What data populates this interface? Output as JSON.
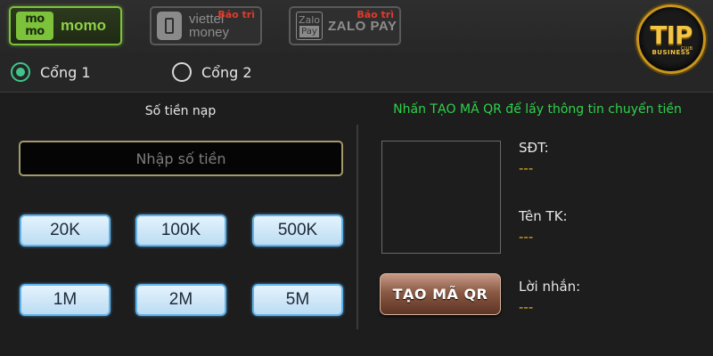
{
  "payment_methods": [
    {
      "logo_top": "mo",
      "logo_bottom": "mo",
      "label": "momo",
      "color": "#7cc23a"
    },
    {
      "label_top": "viettel",
      "label_bottom": "money",
      "badge": "Bảo trì"
    },
    {
      "logo_top": "Zalo",
      "logo_bottom": "Pay",
      "label": "ZALO PAY",
      "badge": "Bảo trì"
    }
  ],
  "brand": {
    "main": "TIP",
    "sub": "BUSINESS",
    "club": "CLUB"
  },
  "gateways": [
    {
      "label": "Cổng 1",
      "selected": true
    },
    {
      "label": "Cổng 2",
      "selected": false
    }
  ],
  "deposit": {
    "title": "Số tiền nạp",
    "placeholder": "Nhập số tiền",
    "amounts": [
      "20K",
      "100K",
      "500K",
      "1M",
      "2M",
      "5M"
    ]
  },
  "qr": {
    "hint": "Nhấn TẠO MÃ QR để lấy thông tin chuyển tiền",
    "button_label": "TẠO MÃ QR",
    "fields": [
      {
        "label": "SĐT:",
        "value": "---"
      },
      {
        "label": "Tên TK:",
        "value": "---"
      },
      {
        "label": "Lời nhắn:",
        "value": "---"
      }
    ]
  },
  "colors": {
    "accent_green": "#2fd14a",
    "value_gold": "#e8b020",
    "maintenance_red": "#e23a2a",
    "radio_on": "#3fc58a"
  }
}
